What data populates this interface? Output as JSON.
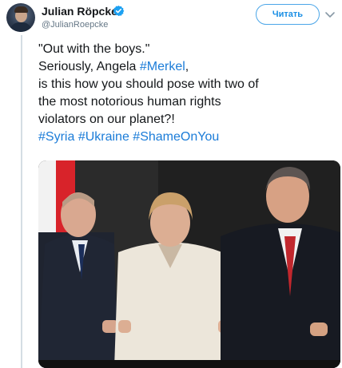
{
  "author": {
    "name": "Julian Röpcke",
    "handle": "@JulianRoepcke",
    "verified": true
  },
  "actions": {
    "follow_label": "Читать"
  },
  "tweet": {
    "line1": "\"Out with the boys.\"",
    "line2_prefix": "Seriously, Angela ",
    "line2_tag": "#Merkel",
    "line2_suffix": ",",
    "line3": "is this how you should pose with two of",
    "line4": "the most notorious human rights",
    "line5": "violators on our planet?!",
    "hashtags": [
      "#Syria",
      "#Ukraine",
      "#ShameOnYou"
    ]
  },
  "colors": {
    "link": "#1b7cd8",
    "verified": "#1da1f2",
    "follow_border": "#4ba6e8"
  },
  "icons": {
    "verified": "verified-badge-icon",
    "more": "chevron-down-icon"
  }
}
